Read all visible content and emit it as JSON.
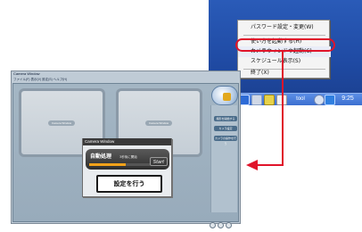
{
  "tray": {
    "menu_items": [
      {
        "label": "パスワード設定・変更(W)"
      },
      {
        "label": "使い方を起動する(H)"
      },
      {
        "label": "カメラウィンドウ起動(C)"
      },
      {
        "label": "スケジュール表示(S)"
      },
      {
        "label": "終了(X)"
      }
    ],
    "tool_label": "tool",
    "clock": "9:25"
  },
  "app": {
    "title": "Camera Window",
    "menubar": "ファイル(F)  表示(V)  設定(S)  ヘルプ(H)",
    "pane_left_label": "Camera Window",
    "pane_right_label": "Camera Window",
    "side_buttons": [
      "撮影を開始する",
      "カメラ設定",
      "カメラの操作を行う"
    ]
  },
  "camera_dialog": {
    "title": "Camera Window",
    "auto_label": "自動処理",
    "hint": "3秒後に開始",
    "start_label": "Start",
    "settings_button": "設定を行う",
    "progress": 0.6
  },
  "colors": {
    "highlight_ring": "#e0142a",
    "arrow": "#e0142a",
    "taskbar": "#3c6fd0",
    "progress": "#f2a21a"
  }
}
